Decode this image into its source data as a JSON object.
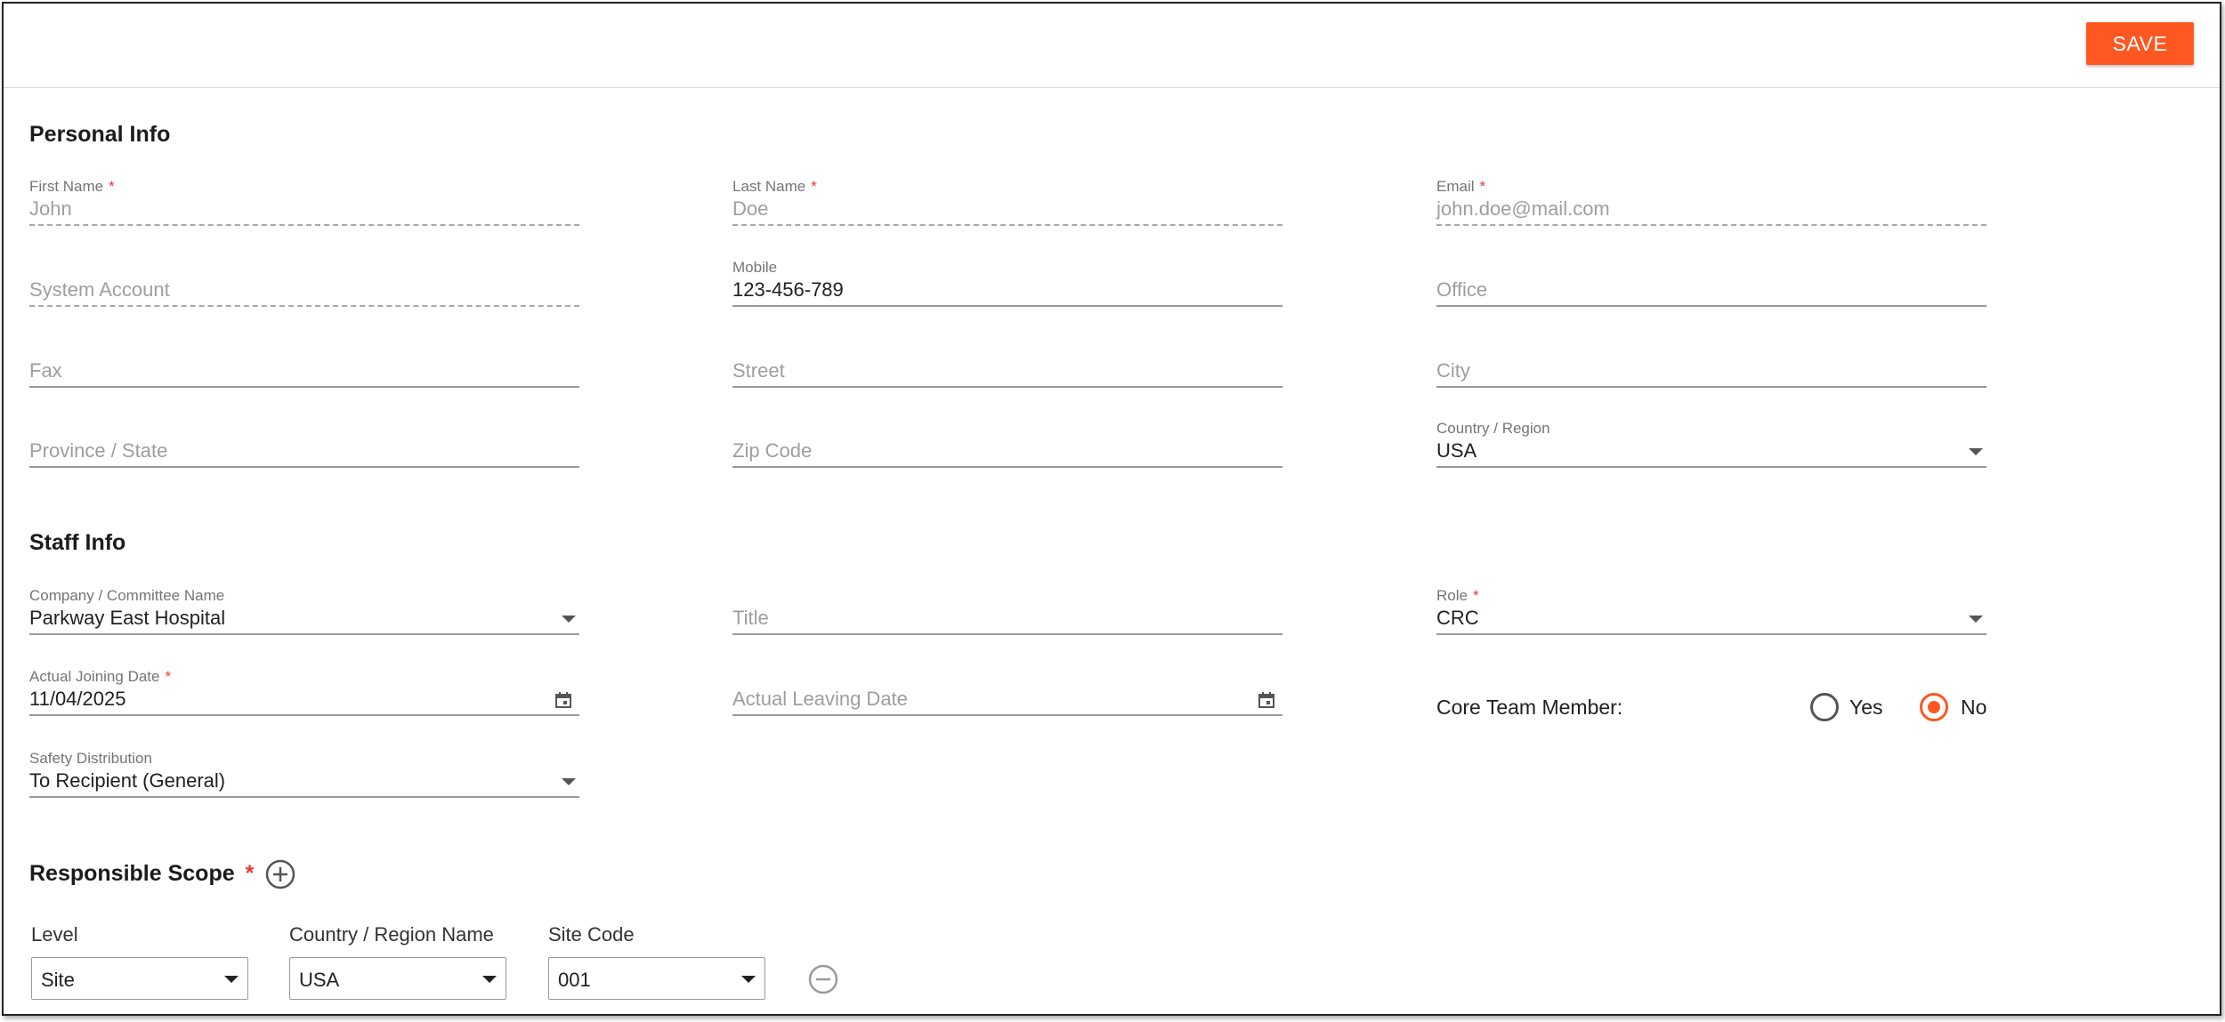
{
  "toolbar": {
    "save_label": "SAVE"
  },
  "personal_info": {
    "title": "Personal Info",
    "first_name": {
      "label": "First Name",
      "required": "*",
      "value": "John"
    },
    "last_name": {
      "label": "Last Name",
      "required": "*",
      "value": "Doe"
    },
    "email": {
      "label": "Email",
      "required": "*",
      "value": "john.doe@mail.com"
    },
    "system_account": {
      "placeholder": "System Account"
    },
    "mobile": {
      "label": "Mobile",
      "value": "123-456-789"
    },
    "office": {
      "placeholder": "Office"
    },
    "fax": {
      "placeholder": "Fax"
    },
    "street": {
      "placeholder": "Street"
    },
    "city": {
      "placeholder": "City"
    },
    "province": {
      "placeholder": "Province / State"
    },
    "zip": {
      "placeholder": "Zip Code"
    },
    "country": {
      "label": "Country / Region",
      "value": "USA"
    }
  },
  "staff_info": {
    "title": "Staff Info",
    "company": {
      "label": "Company / Committee Name",
      "value": "Parkway East Hospital"
    },
    "title_field": {
      "placeholder": "Title"
    },
    "role": {
      "label": "Role",
      "required": "*",
      "value": "CRC"
    },
    "joining_date": {
      "label": "Actual Joining Date",
      "required": "*",
      "value": "11/04/2025"
    },
    "leaving_date": {
      "placeholder": "Actual Leaving Date"
    },
    "core_team": {
      "label": "Core Team Member:",
      "yes": "Yes",
      "no": "No",
      "selected": "No"
    },
    "safety": {
      "label": "Safety Distribution",
      "value": "To Recipient (General)"
    }
  },
  "scope": {
    "title": "Responsible Scope",
    "required": "*",
    "columns": {
      "level": "Level",
      "country": "Country / Region Name",
      "site_code": "Site Code"
    },
    "row": {
      "level": "Site",
      "country": "USA",
      "site_code": "001"
    }
  },
  "colors": {
    "accent": "#ff5722",
    "required": "#e53935"
  },
  "icons": [
    "calendar-icon",
    "chevron-down-icon",
    "add-circle-icon",
    "remove-circle-icon"
  ]
}
